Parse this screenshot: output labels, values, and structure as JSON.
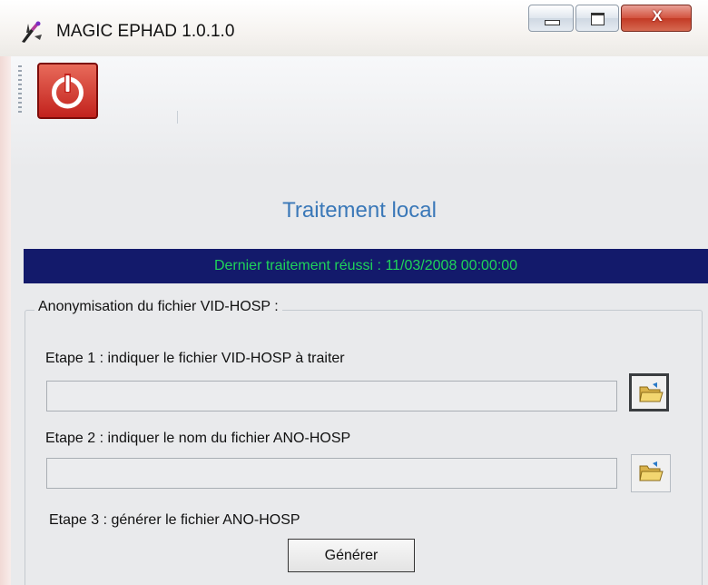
{
  "window": {
    "title": "MAGIC EPHAD 1.0.1.0",
    "app_icon": "magic-wand-icon",
    "controls": {
      "minimize": "minimize-icon",
      "maximize": "maximize-icon",
      "close_glyph": "X"
    }
  },
  "toolbar": {
    "power_icon": "power-icon"
  },
  "page": {
    "title": "Traitement local",
    "status_banner": "Dernier traitement réussi : 11/03/2008 00:00:00"
  },
  "group": {
    "legend": "Anonymisation du fichier VID-HOSP :",
    "step1": {
      "label": "Etape 1 : indiquer le fichier VID-HOSP à traiter",
      "value": "",
      "browse_icon": "folder-open-icon"
    },
    "step2": {
      "label": "Etape 2 : indiquer le nom du fichier ANO-HOSP",
      "value": "",
      "browse_icon": "folder-open-icon"
    },
    "step3": {
      "label": "Etape 3 : générer le fichier ANO-HOSP"
    },
    "generate_button": "Générer"
  },
  "colors": {
    "banner_bg": "#131a6b",
    "banner_text": "#1fd45a",
    "title": "#3a78b8",
    "power": "#c2221d"
  }
}
